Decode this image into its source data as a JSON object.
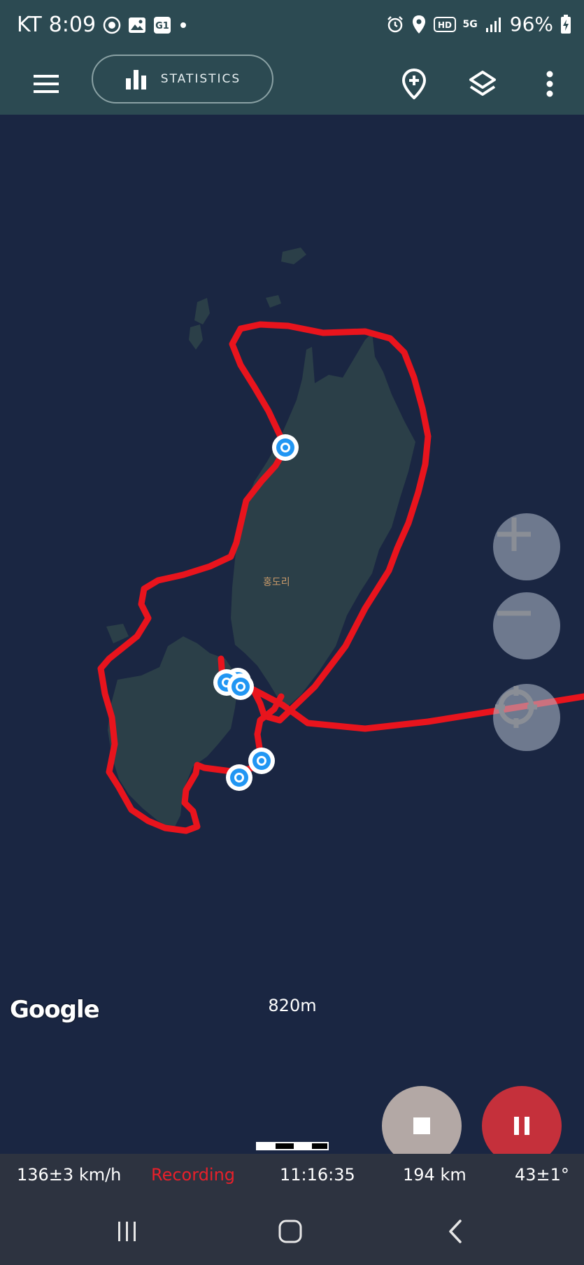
{
  "status_bar": {
    "carrier": "KT",
    "time": "8:09",
    "network": "5G",
    "battery": "96%"
  },
  "toolbar": {
    "statistics_label": "STATISTICS"
  },
  "map": {
    "place_label": "홍도리",
    "provider": "Google",
    "scale_label": "820m"
  },
  "footer": {
    "speed": "136±3 km/h",
    "status": "Recording",
    "elapsed": "11:16:35",
    "distance": "194 km",
    "bearing": "43±1°"
  },
  "colors": {
    "map_bg": "#1a2642",
    "land": "#2b3f48",
    "track": "#e8141d",
    "marker": "#2196f3",
    "app_bar": "#2c4a52",
    "recording": "#e8202a",
    "pause": "#c5303b",
    "stop": "#b3a8a5"
  },
  "icons": [
    "menu-icon",
    "bar-chart-icon",
    "add-location-icon",
    "layers-icon",
    "more-vert-icon",
    "zoom-in-icon",
    "zoom-out-icon",
    "my-location-icon",
    "stop-icon",
    "pause-icon",
    "recents-icon",
    "home-icon",
    "back-icon"
  ]
}
